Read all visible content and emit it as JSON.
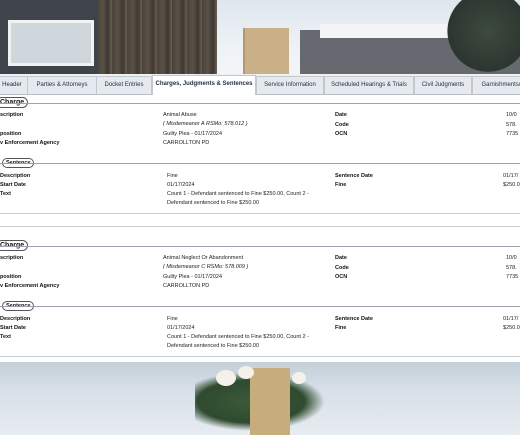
{
  "tabs": [
    {
      "label": "Header"
    },
    {
      "label": "Parties & Attorneys"
    },
    {
      "label": "Docket Entries"
    },
    {
      "label": "Charges, Judgments & Sentences"
    },
    {
      "label": "Service Information"
    },
    {
      "label": "Scheduled Hearings & Trials"
    },
    {
      "label": "Civil Judgments"
    },
    {
      "label": "Garnishments/"
    }
  ],
  "charges": [
    {
      "header": "Charge",
      "description_label": "scription",
      "description": "Animal Abuse",
      "statute": "( Misdemeanor A RSMo: 578.012 )",
      "disposition_label": "position",
      "disposition": "Guilty Plea - 01/17/2024",
      "agency_label": "v Enforcement Agency",
      "agency": "CARROLLTON PD",
      "date_label": "Date",
      "date": "10/0",
      "code_label": "Code",
      "code": "578.",
      "ocn_label": "OCN",
      "ocn": "7735",
      "sentence": {
        "header": "Sentence",
        "desc_label": "Description",
        "desc": "Fine",
        "start_label": "Start Date",
        "start": "01/17/2024",
        "text_label": "Text",
        "text1": "Count 1 - Defendant sentenced to Fine $250.00, Count 2 -",
        "text2": "Defendant sentenced to Fine $250.00",
        "sdate_label": "Sentence Date",
        "sdate": "01/17/",
        "fine_label": "Fine",
        "fine": "$250.0"
      }
    },
    {
      "header": "Charge",
      "description_label": "scription",
      "description": "Animal Neglect Or Abandonment",
      "statute": "( Misdemeanor C RSMo: 578.009 )",
      "disposition_label": "position",
      "disposition": "Guilty Plea - 01/17/2024",
      "agency_label": "v Enforcement Agency",
      "agency": "CARROLLTON PD",
      "date_label": "Date",
      "date": "10/0",
      "code_label": "Code",
      "code": "578.",
      "ocn_label": "OCN",
      "ocn": "7735",
      "sentence": {
        "header": "Sentence",
        "desc_label": "Description",
        "desc": "Fine",
        "start_label": "Start Date",
        "start": "01/17/2024",
        "text_label": "Text",
        "text1": "Count 1 - Defendant sentenced to Fine $250.00, Count 2 -",
        "text2": "Defendant sentenced to Fine $250.00",
        "sdate_label": "Sentence Date",
        "sdate": "01/17/",
        "fine_label": "Fine",
        "fine": "$250.0"
      }
    }
  ]
}
